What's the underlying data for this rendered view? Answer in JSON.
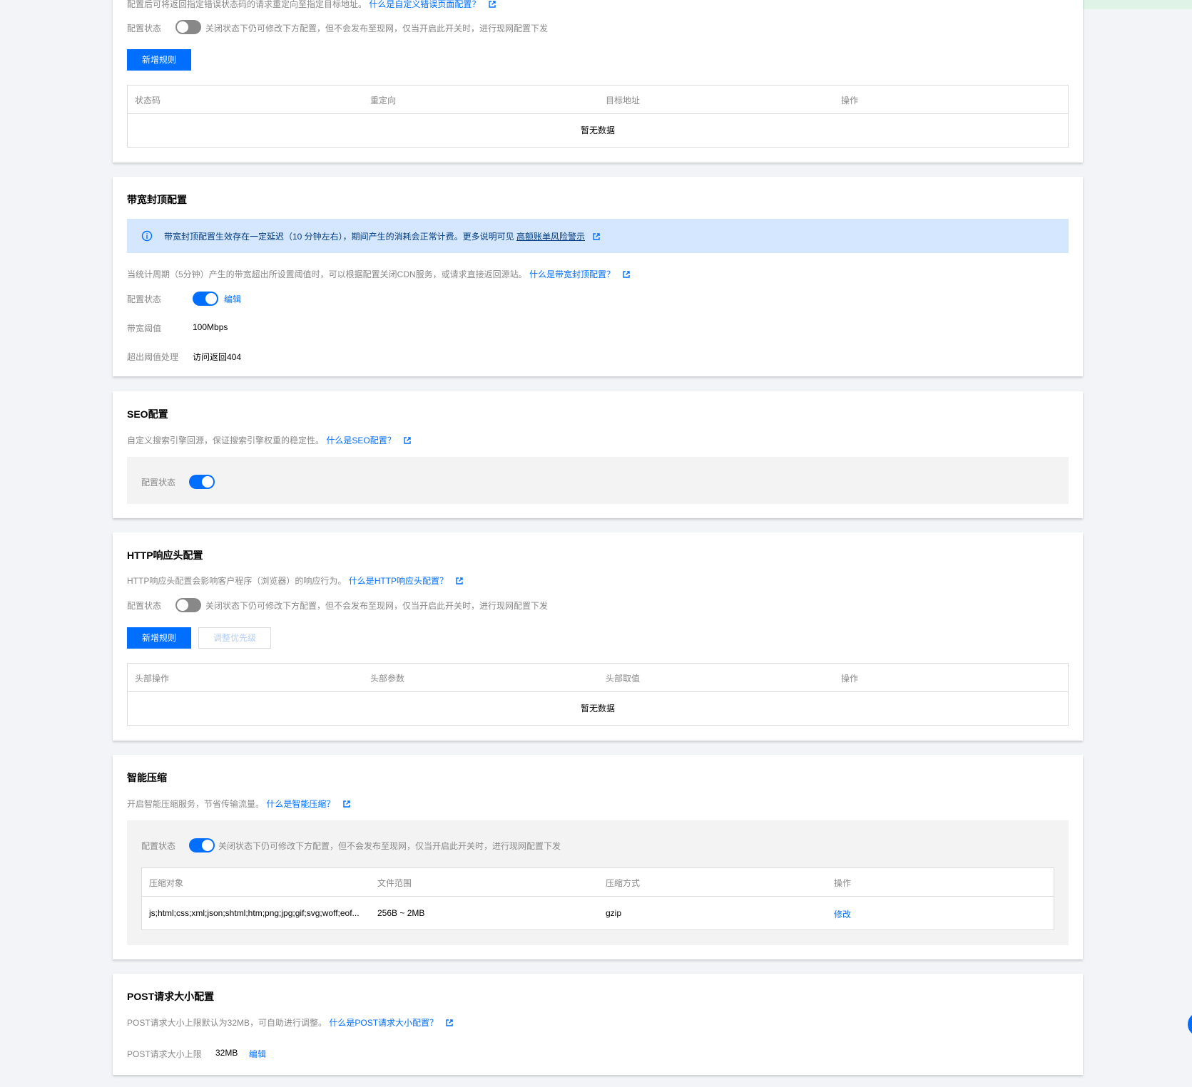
{
  "error_page": {
    "desc": "配置后可将返回指定错误状态码的请求重定向至指定目标地址。",
    "link": "什么是自定义错误页面配置？",
    "status_label": "配置状态",
    "status_tip": "关闭状态下仍可修改下方配置，但不会发布至现网，仅当开启此开关时，进行现网配置下发",
    "add_button": "新增规则",
    "columns": [
      "状态码",
      "重定向",
      "目标地址",
      "操作"
    ],
    "empty": "暂无数据"
  },
  "bandwidth": {
    "title": "带宽封顶配置",
    "notice_prefix": "带宽封顶配置生效存在一定延迟（10 分钟左右），期间产生的消耗会正常计费。更多说明可见",
    "notice_link": "高额账单风险警示",
    "desc": "当统计周期（5分钟）产生的带宽超出所设置阈值时，可以根据配置关闭CDN服务，或请求直接返回源站。",
    "link": "什么是带宽封顶配置？",
    "status_label": "配置状态",
    "edit": "编辑",
    "threshold_label": "带宽阈值",
    "threshold_value": "100Mbps",
    "exceed_label": "超出阈值处理",
    "exceed_value": "访问返回404"
  },
  "seo": {
    "title": "SEO配置",
    "desc": "自定义搜索引擎回源，保证搜索引擎权重的稳定性。",
    "link": "什么是SEO配置？",
    "status_label": "配置状态"
  },
  "http_header": {
    "title": "HTTP响应头配置",
    "desc": "HTTP响应头配置会影响客户程序（浏览器）的响应行为。",
    "link": "什么是HTTP响应头配置？",
    "status_label": "配置状态",
    "status_tip": "关闭状态下仍可修改下方配置，但不会发布至现网，仅当开启此开关时，进行现网配置下发",
    "add_button": "新增规则",
    "priority_button": "调整优先级",
    "columns": [
      "头部操作",
      "头部参数",
      "头部取值",
      "操作"
    ],
    "empty": "暂无数据"
  },
  "compress": {
    "title": "智能压缩",
    "desc": "开启智能压缩服务，节省传输流量。",
    "link": "什么是智能压缩？",
    "status_label": "配置状态",
    "status_tip": "关闭状态下仍可修改下方配置，但不会发布至现网，仅当开启此开关时，进行现网配置下发",
    "columns": [
      "压缩对象",
      "文件范围",
      "压缩方式",
      "操作"
    ],
    "row": {
      "object": "js;html;css;xml;json;shtml;htm;png;jpg;gif;svg;woff;eof...",
      "range": "256B ~ 2MB",
      "method": "gzip",
      "action": "修改"
    }
  },
  "post": {
    "title": "POST请求大小配置",
    "desc": "POST请求大小上限默认为32MB，可自助进行调整。",
    "link": "什么是POST请求大小配置？",
    "limit_label": "POST请求大小上限",
    "limit_value": "32MB",
    "edit": "编辑"
  },
  "colors": {
    "primary": "#006eff",
    "notice_bg": "#d5e7ff",
    "switch_off": "#888888"
  }
}
